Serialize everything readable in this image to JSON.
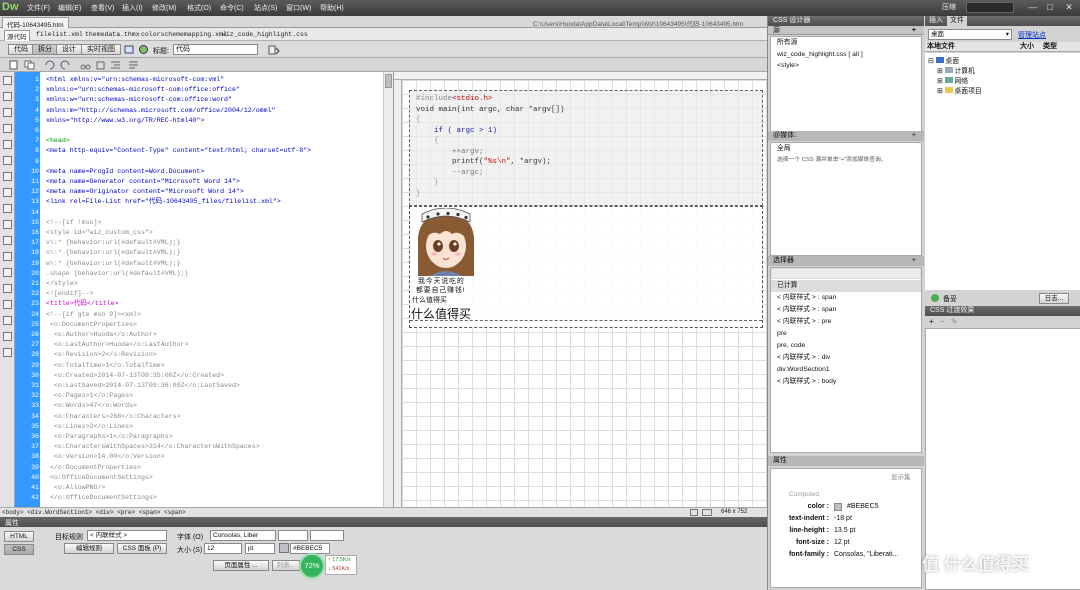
{
  "app": {
    "logo": "Dw",
    "menu": [
      "文件(F)",
      "编辑(E)",
      "查看(V)",
      "插入(I)",
      "修改(M)",
      "格式(O)",
      "命令(C)",
      "站点(S)",
      "窗口(W)",
      "帮助(H)"
    ],
    "workspace_label": "压缩",
    "window_controls": [
      "—",
      "□",
      "✕"
    ]
  },
  "document": {
    "tab_title": "代码-10643495.htm",
    "path": "C:\\Users\\Huoda\\AppData\\Local\\Temp\\Wiz\\10643495\\代码-10643495.htm"
  },
  "related_files": [
    "源代码",
    "filelist.xml",
    "themedata.thmx",
    "colorschememapping.xml",
    "wiz_code_highlight.css"
  ],
  "toolbar": {
    "views": [
      "代码",
      "拆分",
      "设计",
      "实时视图"
    ],
    "title_label": "标题:",
    "title_value": "代码"
  },
  "code_lines": [
    {
      "n": "1",
      "t": "<html xmlns:v=\"urn:schemas-microsoft-com:vml\"",
      "c": "#0000cc"
    },
    {
      "n": "2",
      "t": "xmlns:o=\"urn:schemas-microsoft-com:office:office\"",
      "c": "#0000cc"
    },
    {
      "n": "3",
      "t": "xmlns:w=\"urn:schemas-microsoft-com:office:word\"",
      "c": "#0000cc"
    },
    {
      "n": "4",
      "t": "xmlns:m=\"http://schemas.microsoft.com/office/2004/12/omml\"",
      "c": "#0000cc"
    },
    {
      "n": "5",
      "t": "xmlns=\"http://www.w3.org/TR/REC-html40\">",
      "c": "#0000cc"
    },
    {
      "n": "6",
      "t": "",
      "c": "#000"
    },
    {
      "n": "7",
      "t": "<head>",
      "c": "#009900"
    },
    {
      "n": "8",
      "t": "<meta http-equiv=\"Content-Type\" content=\"text/html; charset=utf-8\">",
      "c": "#0000cc"
    },
    {
      "n": "9",
      "t": "",
      "c": "#000"
    },
    {
      "n": "10",
      "t": "<meta name=ProgId content=Word.Document>",
      "c": "#0000cc"
    },
    {
      "n": "11",
      "t": "<meta name=Generator content=\"Microsoft Word 14\">",
      "c": "#0000cc"
    },
    {
      "n": "12",
      "t": "<meta name=Originator content=\"Microsoft Word 14\">",
      "c": "#0000cc"
    },
    {
      "n": "13",
      "t": "<link rel=File-List href=\"代码-10643495_files/filelist.xml\">",
      "c": "#0000cc"
    },
    {
      "n": "14",
      "t": "",
      "c": "#000"
    },
    {
      "n": "15",
      "t": "<!--[if !mso]>",
      "c": "#888888"
    },
    {
      "n": "16",
      "t": "<style id=\"wiz_custom_css\">",
      "c": "#888888"
    },
    {
      "n": "17",
      "t": "v\\:* {behavior:url(#default#VML);}",
      "c": "#888888"
    },
    {
      "n": "18",
      "t": "o\\:* {behavior:url(#default#VML);}",
      "c": "#888888"
    },
    {
      "n": "19",
      "t": "w\\:* {behavior:url(#default#VML);}",
      "c": "#888888"
    },
    {
      "n": "20",
      "t": ".shape {behavior:url(#default#VML);}",
      "c": "#888888"
    },
    {
      "n": "21",
      "t": "</style>",
      "c": "#888888"
    },
    {
      "n": "22",
      "t": "<![endif]-->",
      "c": "#888888"
    },
    {
      "n": "23",
      "t": "<title>代码</title>",
      "c": "#cc00cc"
    },
    {
      "n": "24",
      "t": "<!--[if gte mso 9]><xml>",
      "c": "#888888"
    },
    {
      "n": "25",
      "t": " <o:DocumentProperties>",
      "c": "#888888"
    },
    {
      "n": "26",
      "t": "  <o:Author>Huoda</o:Author>",
      "c": "#888888"
    },
    {
      "n": "27",
      "t": "  <o:LastAuthor>Huoda</o:LastAuthor>",
      "c": "#888888"
    },
    {
      "n": "28",
      "t": "  <o:Revision>2</o:Revision>",
      "c": "#888888"
    },
    {
      "n": "29",
      "t": "  <o:TotalTime>1</o:TotalTime>",
      "c": "#888888"
    },
    {
      "n": "30",
      "t": "  <o:Created>2014-07-13T09:35:00Z</o:Created>",
      "c": "#888888"
    },
    {
      "n": "31",
      "t": "  <o:LastSaved>2014-07-13T09:36:00Z</o:LastSaved>",
      "c": "#888888"
    },
    {
      "n": "32",
      "t": "  <o:Pages>1</o:Pages>",
      "c": "#888888"
    },
    {
      "n": "33",
      "t": "  <o:Words>47</o:Words>",
      "c": "#888888"
    },
    {
      "n": "34",
      "t": "  <o:Characters>268</o:Characters>",
      "c": "#888888"
    },
    {
      "n": "35",
      "t": "  <o:Lines>2</o:Lines>",
      "c": "#888888"
    },
    {
      "n": "36",
      "t": "  <o:Paragraphs>1</o:Paragraphs>",
      "c": "#888888"
    },
    {
      "n": "37",
      "t": "  <o:CharactersWithSpaces>314</o:CharactersWithSpaces>",
      "c": "#888888"
    },
    {
      "n": "38",
      "t": "  <o:Version>14.00</o:Version>",
      "c": "#888888"
    },
    {
      "n": "39",
      "t": " </o:DocumentProperties>",
      "c": "#888888"
    },
    {
      "n": "40",
      "t": " <o:OfficeDocumentSettings>",
      "c": "#888888"
    },
    {
      "n": "41",
      "t": "  <o:AllowPNG/>",
      "c": "#888888"
    },
    {
      "n": "42",
      "t": " </o:OfficeDocumentSettings>",
      "c": "#888888"
    }
  ],
  "design": {
    "pre_lines": [
      "#include<stdio.h>",
      "void main(int argc, char *argv[])",
      "{",
      "    if ( argc > 1)",
      "    {",
      "        ++argv;",
      "        printf(\"%s\\n\", *argv);",
      "        --argc;",
      "    }",
      "}"
    ],
    "caption_1": "我今天说吃的",
    "caption_2": "都要自己赚钱!",
    "caption_3": "什么值得买",
    "caption_4": "什么值得买"
  },
  "status": {
    "tag_path": "<body> <div.WordSection1> <div> <pre> <span> <span>",
    "window_size": "646 x 752"
  },
  "properties": {
    "header": "属性",
    "html_btn": "HTML",
    "css_btn": "CSS",
    "target_rule_label": "目标规则",
    "target_rule_value": "< 内联样式 >",
    "edit_rule_btn": "编辑规则",
    "css_panel_btn": "CSS 面板 (P)",
    "font_label": "字体 (O)",
    "font_value": "Consolas, Liber",
    "size_label": "大小 (S)",
    "size_value": "12",
    "unit_value": "pt",
    "color_value": "#BEBEC5",
    "page_props_btn": "页面属性 ...",
    "list_item_btn": "列表...",
    "badge": "72%",
    "speed_up": "17.5K/s",
    "speed_down": "541K/s"
  },
  "right": {
    "css_designer_tab": "CSS 设计器",
    "insert_tab": "插入",
    "files_tab": "文件",
    "source_label": "源",
    "sources": [
      "所有源",
      "wiz_code_highlight.css  [ all ]",
      "<style>"
    ],
    "media_label": "@媒体:",
    "media_global": "全局",
    "media_hint": "选择一个 CSS 源并单击\"+\"添加媒体查询。",
    "selectors_label": "选择器",
    "computed_label": "已计算",
    "selectors": [
      "< 内联样式 > : span",
      "< 内联样式 > : span",
      "< 内联样式 > : pre",
      "pre",
      "pre, code",
      "< 内联样式 > : div",
      "div.WordSection1",
      "< 内联样式 > : body"
    ],
    "properties_label": "属性",
    "show_set": "显示集",
    "computed_sub": "Computed",
    "props": [
      {
        "k": "color :",
        "v": "#BEBEC5"
      },
      {
        "k": "text-indent :",
        "v": "-18 pt"
      },
      {
        "k": "line-height :",
        "v": "13.5 pt"
      },
      {
        "k": "font-size :",
        "v": "12 pt"
      },
      {
        "k": "font-family :",
        "v": "Consolas, \"Liberati..."
      }
    ],
    "files": {
      "location": "桌面",
      "manage_sites": "管理站点",
      "col_local": "本地文件",
      "col_size": "大小",
      "col_type": "类型",
      "tree": [
        "桌面",
        "计算机",
        "网络",
        "桌面项目"
      ]
    },
    "backup": "备妥",
    "log": "日志...",
    "css_transition": "CSS 过渡效果"
  },
  "watermark": "值 什么值得买",
  "colors": {
    "accent": "#3399ff",
    "badge": "#36b35f"
  }
}
